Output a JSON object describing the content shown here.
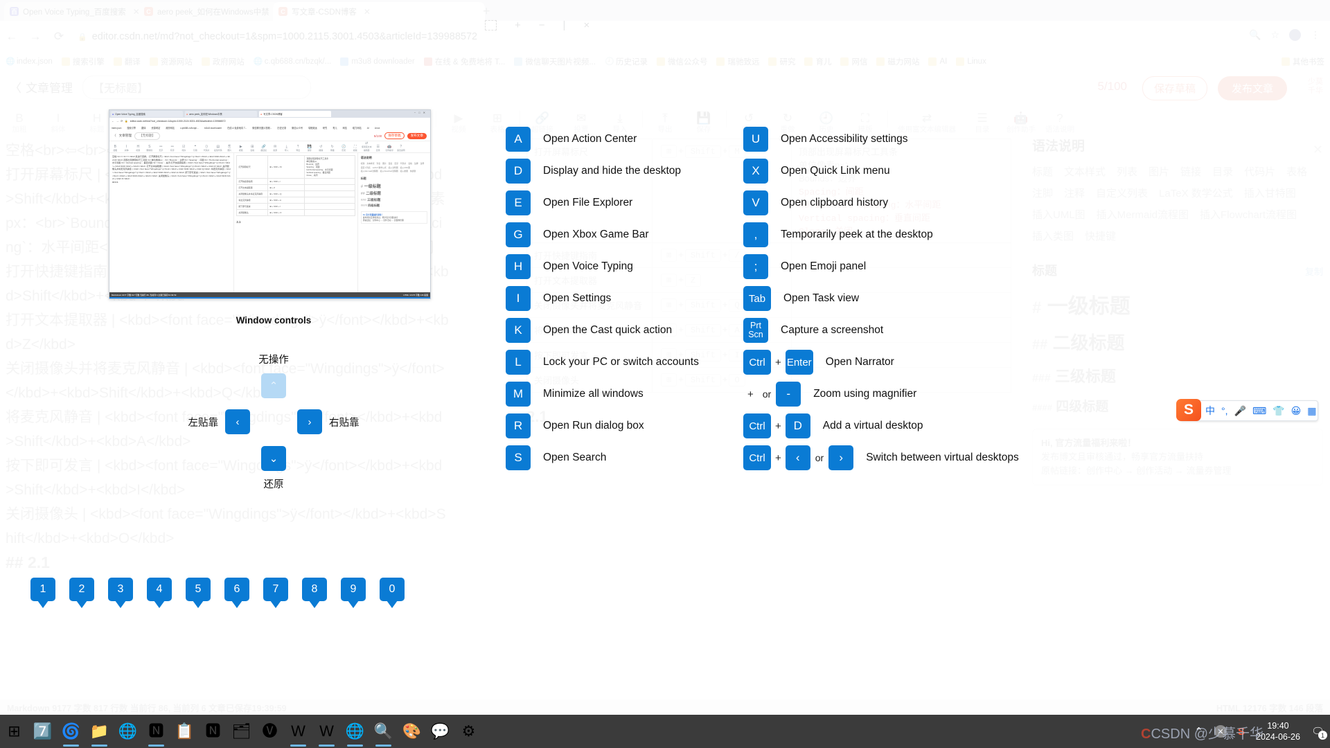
{
  "browser": {
    "tabs": [
      {
        "title": "Open Voice Typing_百度搜索",
        "favicon": "baidu-icon",
        "active": false
      },
      {
        "title": "aero peek_如何在Windows中禁",
        "favicon": "csdn-icon",
        "active": false
      },
      {
        "title": "写文章-CSDN博客",
        "favicon": "csdn-icon",
        "active": true
      }
    ],
    "new_tab_label": "+",
    "nav": {
      "back": "←",
      "forward": "→",
      "reload": "⟳"
    },
    "url": "editor.csdn.net/md?not_checkout=1&spm=1000.2115.3001.4503&articleId=139988572",
    "lock_icon": "lock-icon",
    "bookmarks": [
      "index.json",
      "搜索引擎",
      "翻译",
      "资源网站",
      "政府网站",
      "c.qb688.cn/bzqk/...",
      "m3u8 downloader",
      "在线 & 免费地将 T...",
      "微信聊天图片视频...",
      "历史记录",
      "微信公众号",
      "瑞驰致远",
      "研究",
      "育儿",
      "网信",
      "磁力网站",
      "AI",
      "Linux"
    ],
    "bookmarks_overflow": "其他书签"
  },
  "window_chrome": {
    "snap_label": "snap-layout-icon",
    "maximize_label": "+",
    "minimize_label": "−",
    "divider": "|",
    "close_label": "×"
  },
  "editor": {
    "back_label": "〈",
    "manage_label": "文章管理",
    "title_value": "【无标题】",
    "char_count": "5/100",
    "save_draft": "保存草稿",
    "publish": "发布文章",
    "watermark_line1": "少莫",
    "watermark_line2": "千华",
    "toolbar": [
      {
        "icon": "B",
        "label": "加粗"
      },
      {
        "icon": "I",
        "label": "斜体"
      },
      {
        "icon": "H",
        "label": "标题"
      },
      {
        "icon": "S",
        "label": "删除线"
      },
      {
        "icon": "≔",
        "label": "无序"
      },
      {
        "icon": "≕",
        "label": "有序"
      },
      {
        "icon": "☑",
        "label": "待办"
      },
      {
        "icon": "❝",
        "label": "引用"
      },
      {
        "icon": "⟨⟩",
        "label": "代码片"
      },
      {
        "icon": "▤",
        "label": "段落代码"
      },
      {
        "icon": "⎘",
        "label": "图片"
      },
      {
        "icon": "▶",
        "label": "视频"
      },
      {
        "icon": "⊞",
        "label": "表格"
      },
      {
        "icon": "🔗",
        "label": "超链接"
      },
      {
        "icon": "✉",
        "label": "投票"
      },
      {
        "icon": "⤓",
        "label": "导入"
      },
      {
        "icon": "⤒",
        "label": "导出"
      },
      {
        "icon": "💾",
        "label": "保存"
      },
      {
        "icon": "↺",
        "label": "撤销"
      },
      {
        "icon": "↻",
        "label": "重做"
      },
      {
        "icon": "🕘",
        "label": "历史"
      },
      {
        "icon": "⛶",
        "label": "模版"
      },
      {
        "icon": "⇄",
        "label": "使用富文本编辑器"
      },
      {
        "icon": "☰",
        "label": "目录"
      },
      {
        "icon": "🤖",
        "label": "创作助手"
      },
      {
        "icon": "?",
        "label": "语法说明"
      }
    ],
    "doc_text": "空格<br>⇦<br>⇨</kbd>来进行选择。\n打开屏幕标尺 | <kbd><font face=\"Wingdings\">ÿ</font></kbd>+<kbd>Shift</kbd>+<kbd>M</kbd>|顶部出现屏幕标尺工具条<br>单位像素px：<br>`Bounds`：边界<br>`Spacing`：间距<br>`Horizontal spacing`：水平间距<br>`Vertical spacing`：垂直间距<br>`Close`：关闭\n打开快捷键指南 | <kbd><font face=\"Wingdings\">ÿ</font></kbd>+<kbd>Shift</kbd>+<kbd>/</kbd>\n打开文本提取器 | <kbd><font face=\"Wingdings\">ÿ</font></kbd>+<kbd>Z</kbd>\n关闭摄像头并将麦克风静音 | <kbd><font face=\"Wingdings\">ÿ</font></kbd>+<kbd>Shift</kbd>+<kbd>Q</kbd>\n将麦克风静音 | <kbd><font face=\"Wingdings\">ÿ</font></kbd>+<kbd>Shift</kbd>+<kbd>A</kbd>\n按下即可发言 | <kbd><font face=\"Wingdings\">ÿ</font></kbd>+<kbd>Shift</kbd>+<kbd>I</kbd>\n关闭摄像头 | <kbd><font face=\"Wingdings\">ÿ</font></kbd>+<kbd>Shift</kbd>+<kbd>O</kbd>",
    "doc_heading": "## 2.1",
    "preview_rows": [
      {
        "name": "打开屏幕标尺",
        "keys": [
          "⊞",
          "Shift",
          "M"
        ],
        "note": "顶部出现屏幕标尺工具条\n单位像素px：\nBounds：边界\nSpacing：间距\nHorizontal spacing：水平间距\nVertical spacing：垂直间距\nClose：关闭"
      },
      {
        "name": "打开快捷键指南",
        "keys": [
          "⊞",
          "Shift",
          "/"
        ],
        "note": ""
      },
      {
        "name": "打开文本提取器",
        "keys": [
          "⊞",
          "Z"
        ],
        "note": ""
      },
      {
        "name": "关闭摄像头并将麦克风静音",
        "keys": [
          "⊞",
          "Shift",
          "Q"
        ],
        "note": ""
      },
      {
        "name": "将麦克风静音",
        "keys": [
          "⊞",
          "Shift",
          "A"
        ],
        "note": ""
      },
      {
        "name": "按下即可发言",
        "keys": [
          "⊞",
          "Shift",
          "I"
        ],
        "note": ""
      },
      {
        "name": "关闭摄像头",
        "keys": [
          "⊞",
          "Shift",
          "O"
        ],
        "note": ""
      }
    ],
    "preview_heading": "2.1",
    "sidebar": {
      "title": "语法说明",
      "close": "✕",
      "chips": [
        "标题",
        "文本样式",
        "列表",
        "图片",
        "链接",
        "目录",
        "代码片",
        "表格",
        "注脚",
        "注释",
        "自定义列表",
        "LaTeX 数学公式",
        "插入甘特图",
        "插入UML图",
        "插入Mermaid流程图",
        "插入Flowchart流程图",
        "插入类图",
        "快捷键"
      ],
      "section_title": "标题",
      "copy_label": "复制",
      "headings": [
        {
          "hash": "#",
          "text": "一级标题"
        },
        {
          "hash": "##",
          "text": "二级标题"
        },
        {
          "hash": "###",
          "text": "三级标题"
        },
        {
          "hash": "####",
          "text": "四级标题"
        }
      ],
      "promo_title": "Hi, 官方流量福利来啦！",
      "promo_line1": "发布博文且审核通过，畅享官方流量扶持",
      "promo_line2": "原帖链接：创作中心 → 创作活动 → 流量券管理",
      "promo_close": "✕"
    },
    "statusbar_left": "Markdown  9177 字数  817 行数  当前行 86, 当前列 6  文章已保存19:39:59",
    "statusbar_right": "HTML  12176 字数  146 段落"
  },
  "overlay": {
    "shortcuts_left": [
      {
        "keys": [
          "A"
        ],
        "desc": "Open Action Center"
      },
      {
        "keys": [
          "D"
        ],
        "desc": "Display and hide the desktop"
      },
      {
        "keys": [
          "E"
        ],
        "desc": "Open File Explorer"
      },
      {
        "keys": [
          "G"
        ],
        "desc": "Open Xbox Game Bar"
      },
      {
        "keys": [
          "H"
        ],
        "desc": "Open Voice Typing"
      },
      {
        "keys": [
          "I"
        ],
        "desc": "Open Settings"
      },
      {
        "keys": [
          "K"
        ],
        "desc": "Open the Cast quick action"
      },
      {
        "keys": [
          "L"
        ],
        "desc": "Lock your PC or switch accounts"
      },
      {
        "keys": [
          "M"
        ],
        "desc": "Minimize all windows"
      },
      {
        "keys": [
          "R"
        ],
        "desc": "Open Run dialog box"
      },
      {
        "keys": [
          "S"
        ],
        "desc": "Open Search"
      }
    ],
    "shortcuts_right": [
      {
        "keys": [
          "U"
        ],
        "desc": "Open Accessibility settings"
      },
      {
        "keys": [
          "X"
        ],
        "desc": "Open Quick Link menu"
      },
      {
        "keys": [
          "V"
        ],
        "desc": "Open clipboard history"
      },
      {
        "keys": [
          ","
        ],
        "desc": "Temporarily peek at the desktop"
      },
      {
        "keys": [
          ";"
        ],
        "desc": "Open Emoji panel"
      },
      {
        "keys": [
          "Tab"
        ],
        "desc": "Open Task view"
      },
      {
        "keys": [
          "Prt\nScn"
        ],
        "desc": "Capture a screenshot"
      },
      {
        "keys": [
          "Ctrl",
          "+",
          "Enter"
        ],
        "desc": "Open Narrator"
      },
      {
        "keys": [
          "+",
          "or",
          "-"
        ],
        "desc": "Zoom using magnifier"
      },
      {
        "keys": [
          "Ctrl",
          "+",
          "D"
        ],
        "desc": "Add a virtual desktop"
      },
      {
        "keys": [
          "Ctrl",
          "+",
          "‹",
          "or",
          "›"
        ],
        "desc": "Switch between virtual desktops"
      }
    ],
    "window_controls": {
      "title": "Window controls",
      "up_label": "无操作",
      "up_glyph": "⌃",
      "left_label": "左贴靠",
      "left_glyph": "‹",
      "right_label": "右贴靠",
      "right_glyph": "›",
      "down_label": "还原",
      "down_glyph": "⌄"
    },
    "number_keys": [
      "1",
      "2",
      "3",
      "4",
      "5",
      "6",
      "7",
      "8",
      "9",
      "0"
    ]
  },
  "ime": {
    "logo": "sogou-logo",
    "items": [
      "中",
      "°,",
      "mic-icon",
      "keyboard-icon",
      "skin-icon",
      "emoji-icon",
      "apps-icon"
    ]
  },
  "taskbar": {
    "items": [
      {
        "name": "start-button",
        "glyph": "⊞",
        "running": false
      },
      {
        "name": "7zip-icon",
        "glyph": "7️⃣",
        "running": false
      },
      {
        "name": "edge-icon",
        "glyph": "🌀",
        "running": true
      },
      {
        "name": "file-explorer-icon",
        "glyph": "📁",
        "running": true
      },
      {
        "name": "chrome-icon",
        "glyph": "🌐",
        "running": false
      },
      {
        "name": "visual-studio-icon",
        "glyph": "🅽",
        "running": true
      },
      {
        "name": "snipaste-icon",
        "glyph": "📋",
        "running": false
      },
      {
        "name": "visual-studio-2-icon",
        "glyph": "🅽",
        "running": false
      },
      {
        "name": "everything-icon",
        "glyph": "🗂",
        "running": false
      },
      {
        "name": "vscode-icon",
        "glyph": "🅥",
        "running": false
      },
      {
        "name": "wps-writer-icon",
        "glyph": "W",
        "running": true
      },
      {
        "name": "wps-writer-2-icon",
        "glyph": "W",
        "running": true
      },
      {
        "name": "chrome-beta-icon",
        "glyph": "🌐",
        "running": true
      },
      {
        "name": "everything-search-icon",
        "glyph": "🔍",
        "running": true
      },
      {
        "name": "colorpicker-icon",
        "glyph": "🎨",
        "running": false
      },
      {
        "name": "wechat-icon",
        "glyph": "💬",
        "running": false
      },
      {
        "name": "settings-icon",
        "glyph": "⚙",
        "running": false
      }
    ],
    "tray": {
      "chevron": "⌃",
      "close_badge": "✕",
      "csdn_logo": "csdn-icon",
      "time": "19:40",
      "date": "2024-06-26",
      "notification_count": "1"
    },
    "watermark": "CSDN @少慕千华"
  }
}
